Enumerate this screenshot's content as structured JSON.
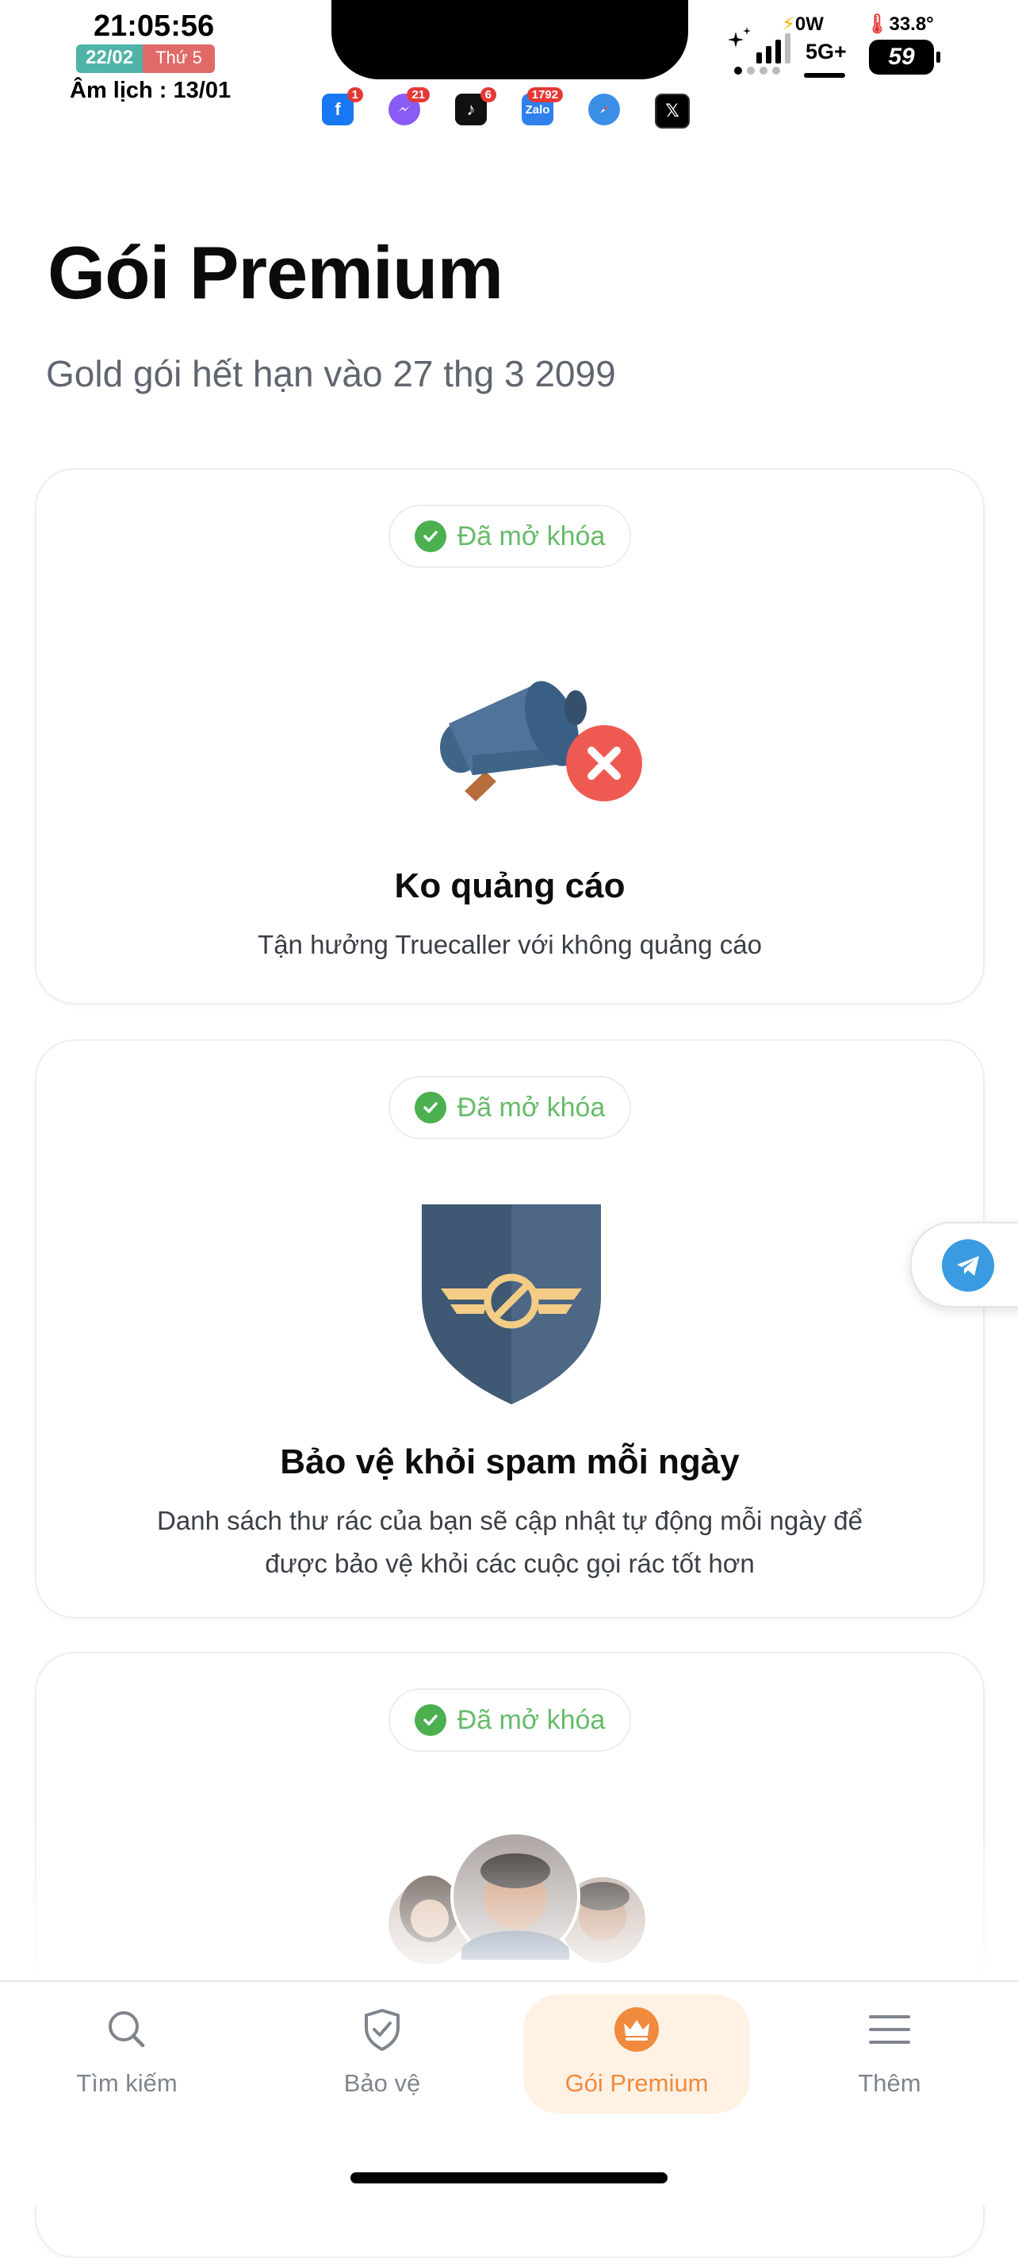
{
  "status_bar": {
    "time": "21:05:56",
    "date": "22/02",
    "weekday": "Thứ 5",
    "lunar": "Âm lịch : 13/01",
    "power": "0W",
    "network": "5G+",
    "temperature": "33.8°",
    "battery": "59",
    "apps": [
      {
        "name": "Facebook",
        "badge": "1",
        "color": "#1877f2"
      },
      {
        "name": "Messenger",
        "badge": "21",
        "color": "#8a5cf6"
      },
      {
        "name": "TikTok",
        "badge": "6",
        "color": "#111111"
      },
      {
        "name": "Zalo",
        "badge": "1792",
        "color": "#2f80ed"
      },
      {
        "name": "Safari",
        "badge": "",
        "color": "#3a8ee6"
      },
      {
        "name": "X",
        "badge": "",
        "color": "#000000"
      }
    ]
  },
  "header": {
    "title": "Gói Premium",
    "expiry": "Gold gói hết hạn vào 27 thg 3 2099"
  },
  "cards": [
    {
      "badge": "Đã mở khóa",
      "title": "Ko quảng cáo",
      "description": "Tận hưởng Truecaller với không quảng cáo",
      "icon": "megaphone-no-ads-icon"
    },
    {
      "badge": "Đã mở khóa",
      "title": "Bảo vệ khỏi spam mỗi ngày",
      "description": "Danh sách thư rác của bạn sẽ cập nhật tự động mỗi ngày để được bảo vệ khỏi các cuộc gọi rác tốt hơn",
      "icon": "spam-shield-icon"
    },
    {
      "badge": "Đã mở khóa",
      "icon": "contact-avatars-icon"
    }
  ],
  "nav": {
    "items": [
      {
        "label": "Tìm kiếm",
        "icon": "search-icon"
      },
      {
        "label": "Bảo vệ",
        "icon": "shield-check-icon"
      },
      {
        "label": "Gói Premium",
        "icon": "crown-icon",
        "active": true
      },
      {
        "label": "Thêm",
        "icon": "menu-icon"
      }
    ]
  },
  "colors": {
    "accent": "#f08a3c",
    "unlocked_green": "#4caf50",
    "shield_blue": "#3f5873",
    "no_ads_red": "#ee5a52"
  }
}
